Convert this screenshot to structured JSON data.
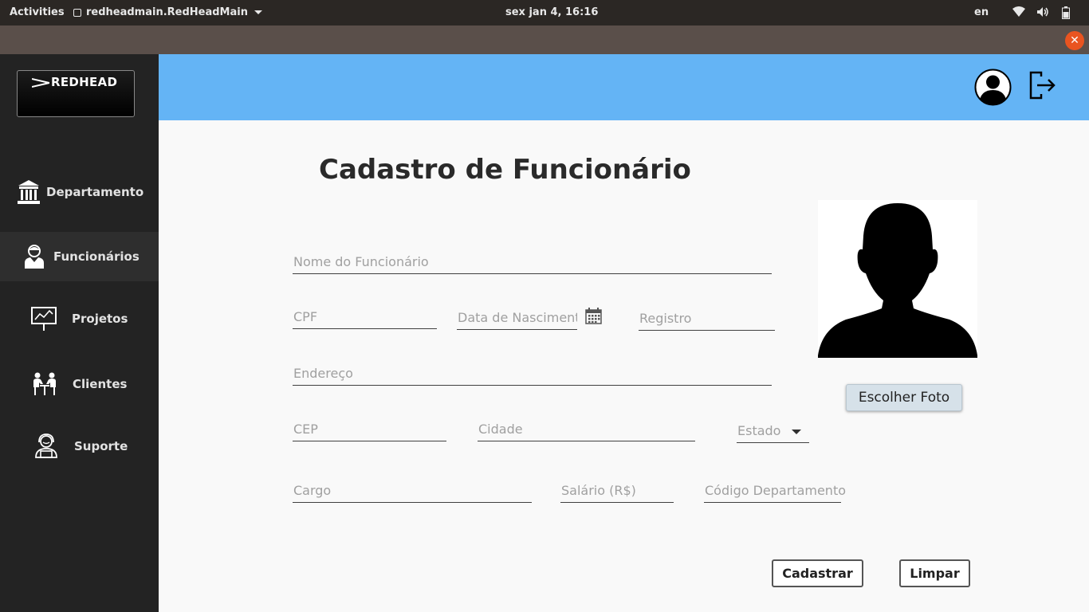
{
  "system_bar": {
    "activities": "Activities",
    "app_name": "redheadmain.RedHeadMain",
    "clock": "sex jan  4, 16:16",
    "language": "en"
  },
  "sidebar": {
    "logo_text": "REDHEAD",
    "items": [
      {
        "label": "Departamento",
        "icon": "bank-icon",
        "active": false
      },
      {
        "label": "Funcionários",
        "icon": "employee-icon",
        "active": true
      },
      {
        "label": "Projetos",
        "icon": "presentation-icon",
        "active": false
      },
      {
        "label": "Clientes",
        "icon": "meeting-icon",
        "active": false
      },
      {
        "label": "Suporte",
        "icon": "support-agent-icon",
        "active": false
      }
    ]
  },
  "header": {
    "bg_color": "#64b4f5",
    "profile_icon": "user-circle-icon",
    "logout_icon": "logout-icon"
  },
  "form": {
    "title": "Cadastro de Funcionário",
    "fields": {
      "nome": "Nome do Funcionário",
      "cpf": "CPF",
      "data_nascimento": "Data de Nasciment",
      "registro": "Registro",
      "endereco": "Endereço",
      "cep": "CEP",
      "cidade": "Cidade",
      "estado": "Estado",
      "cargo": "Cargo",
      "salario": "Salário (R$)",
      "codigo_departamento": "Código Departamento"
    },
    "choose_photo_label": "Escolher Foto",
    "submit_label": "Cadastrar",
    "clear_label": "Limpar"
  }
}
